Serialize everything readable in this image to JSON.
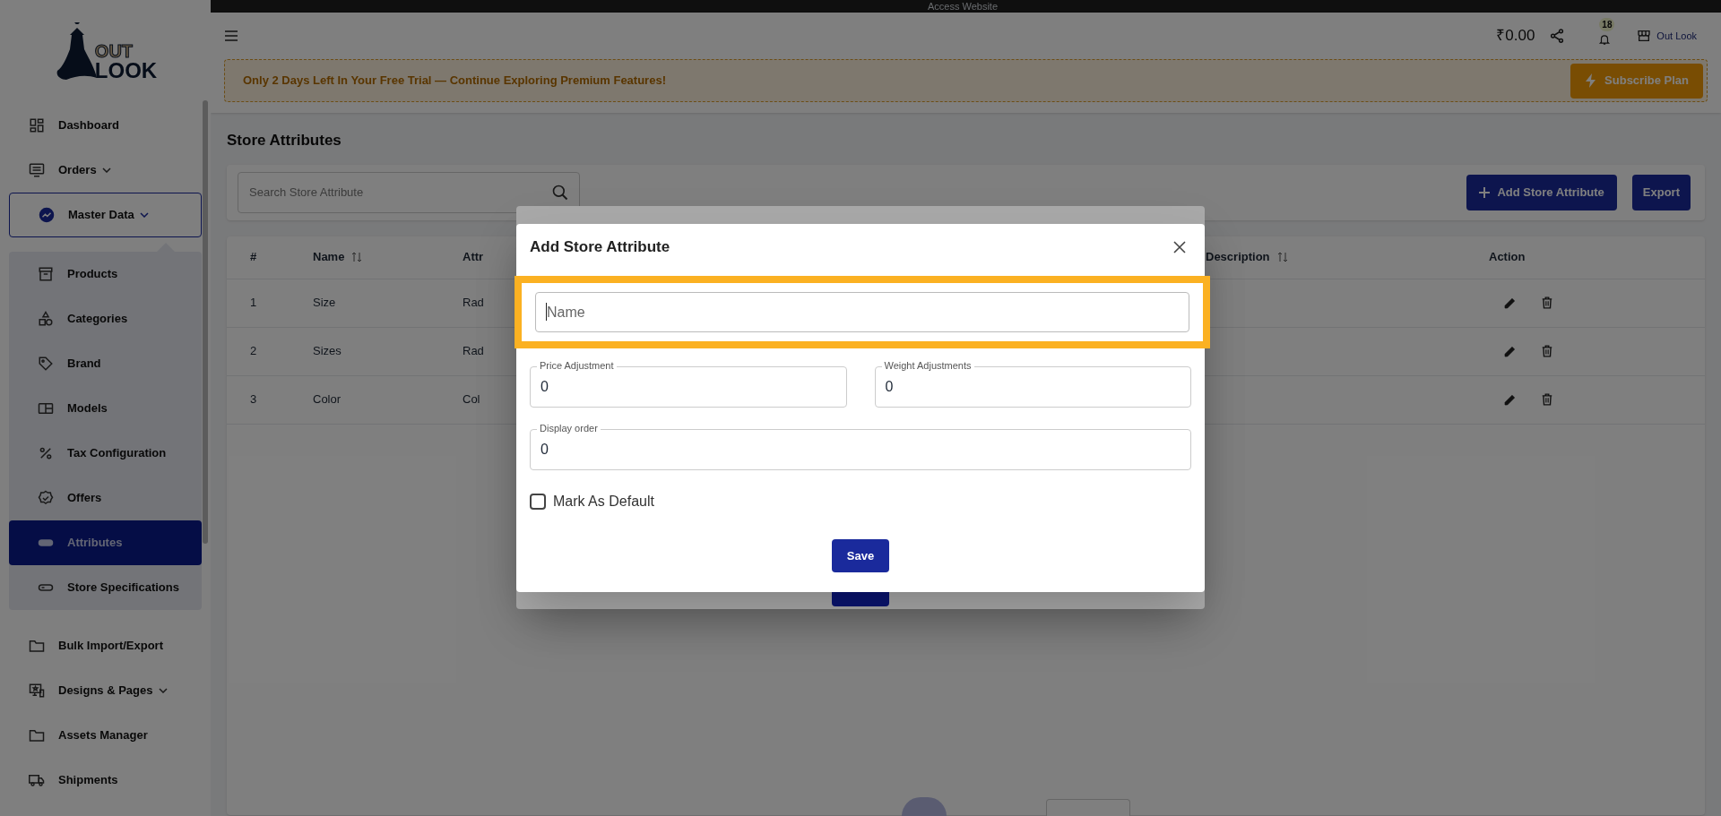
{
  "logo": {
    "top": "OUT",
    "bottom": "LOOK"
  },
  "top_bar": {
    "link": "Access Website"
  },
  "header": {
    "balance": "₹0.00",
    "notifications": "18",
    "store_name": "Out Look"
  },
  "trial_banner": {
    "message": "Only 2 Days Left In Your Free Trial — Continue Exploring Premium Features!",
    "button": "Subscribe Plan"
  },
  "sidebar": {
    "items": [
      {
        "label": "Dashboard",
        "selected": false
      },
      {
        "label": "Orders",
        "selected": false,
        "expanded": false
      },
      {
        "label": "Master Data",
        "selected": false,
        "expanded": true,
        "children": [
          {
            "label": "Products",
            "selected": false
          },
          {
            "label": "Categories",
            "selected": false
          },
          {
            "label": "Brand",
            "selected": false
          },
          {
            "label": "Models",
            "selected": false
          },
          {
            "label": "Tax Configuration",
            "selected": false
          },
          {
            "label": "Offers",
            "selected": false
          },
          {
            "label": "Attributes",
            "selected": true
          },
          {
            "label": "Store Specifications",
            "selected": false
          }
        ]
      },
      {
        "label": "Bulk Import/Export",
        "selected": false
      },
      {
        "label": "Designs & Pages",
        "selected": false,
        "expanded": false
      },
      {
        "label": "Assets Manager",
        "selected": false
      },
      {
        "label": "Shipments",
        "selected": false
      }
    ]
  },
  "page": {
    "title": "Store Attributes",
    "search_placeholder": "Search Store Attribute",
    "buttons": [
      "Add Store Attribute",
      "Export"
    ]
  },
  "table": {
    "columns": [
      {
        "label": "#",
        "sortable": false
      },
      {
        "label": "Name",
        "sortable": true
      },
      {
        "label": "Attr",
        "sortable": false
      },
      {
        "label": "Description",
        "sortable": true
      },
      {
        "label": "Action",
        "sortable": false
      }
    ],
    "rows": [
      [
        "1",
        "Size",
        "Rad"
      ],
      [
        "2",
        "Sizes",
        "Rad"
      ],
      [
        "3",
        "Color",
        "Col"
      ]
    ]
  },
  "dialog": {
    "title": "Add Store Attribute",
    "name_field": {
      "placeholder": "Name",
      "focused": true,
      "highlighted": true
    },
    "fields": [
      {
        "label": "Price Adjustment",
        "value": "0"
      },
      {
        "label": "Weight Adjustments",
        "value": "0"
      },
      {
        "label": "Display order",
        "value": "0"
      }
    ],
    "checkbox": {
      "label": "Mark As Default",
      "checked": false
    },
    "button": "Save"
  }
}
